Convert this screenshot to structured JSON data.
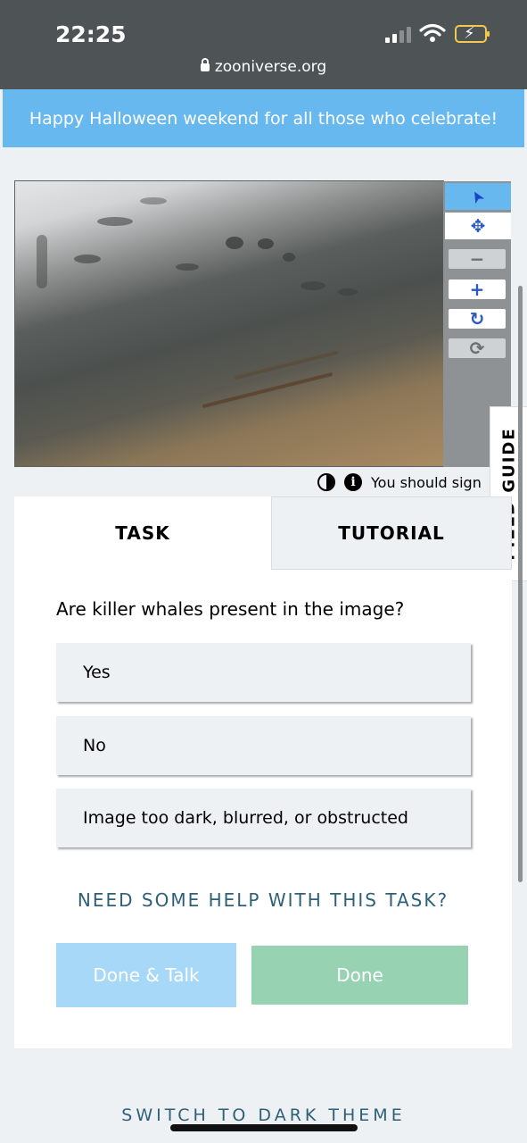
{
  "status_bar": {
    "time": "22:25",
    "url": "zooniverse.org"
  },
  "banner": {
    "text": "Happy Halloween weekend for all those who celebrate!"
  },
  "viewer": {
    "toolbar": {
      "tools": [
        {
          "name": "pointer",
          "icon": "arrow-pointer-icon",
          "glyph": "➤",
          "active": true
        },
        {
          "name": "pan",
          "icon": "move-arrows-icon",
          "glyph": "✥",
          "active": false
        },
        {
          "name": "zoom-out",
          "icon": "minus-icon",
          "glyph": "−",
          "active": false
        },
        {
          "name": "zoom-in",
          "icon": "plus-icon",
          "glyph": "+",
          "active": false
        },
        {
          "name": "rotate",
          "icon": "rotate-icon",
          "glyph": "↻",
          "active": false
        },
        {
          "name": "reset",
          "icon": "refresh-icon",
          "glyph": "⟳",
          "active": false
        }
      ]
    },
    "info_text": "You should sign"
  },
  "field_guide": {
    "label": "FIELD GUIDE"
  },
  "tabs": {
    "task": "TASK",
    "tutorial": "TUTORIAL"
  },
  "task": {
    "question": "Are killer whales present in the image?",
    "answers": [
      "Yes",
      "No",
      "Image too dark, blurred, or obstructed"
    ],
    "help_link": "NEED SOME HELP WITH THIS TASK?",
    "done_talk_label": "Done & Talk",
    "done_label": "Done"
  },
  "footer": {
    "theme_toggle": "SWITCH TO DARK THEME"
  },
  "colors": {
    "banner": "#68b8f0",
    "active_tool": "#68b8f0",
    "done_talk": "#a8d8f7",
    "done": "#97d3b3",
    "link": "#2e6078"
  }
}
